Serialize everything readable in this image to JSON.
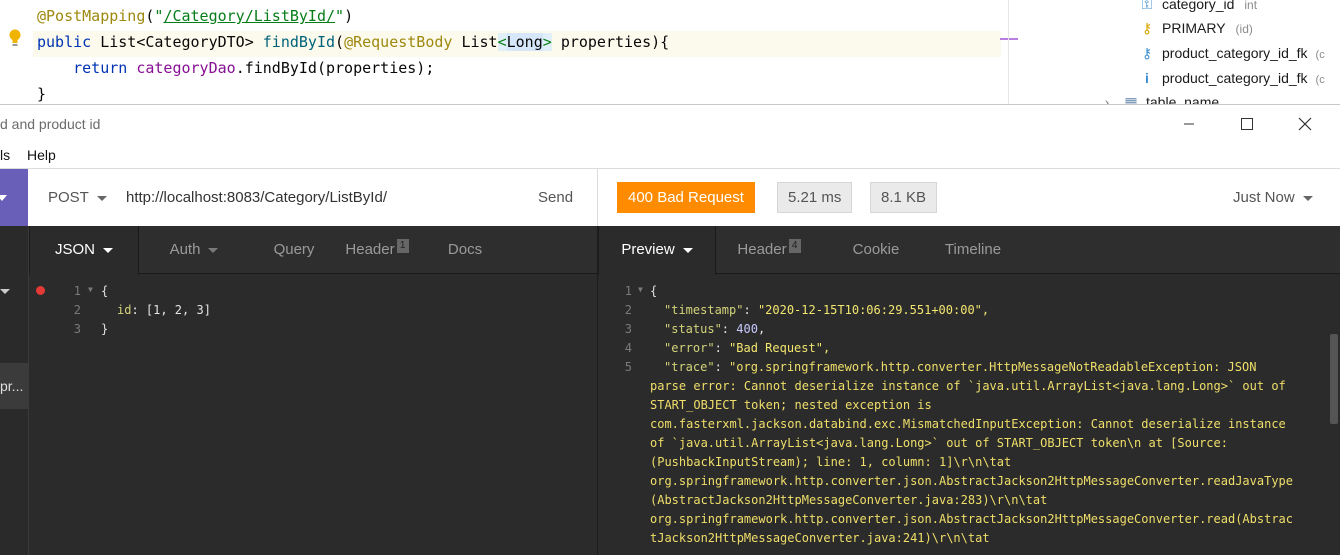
{
  "ide": {
    "lines": [
      {
        "annotation": "@PostMapping",
        "open": "(",
        "quote_open": "\"",
        "path": "/Category/ListById/",
        "quote_close": "\"",
        "close": ")"
      },
      {
        "kw": "public",
        "type": "List<CategoryDTO>",
        "method": "findById",
        "p_open": "(",
        "param_ann": "@RequestBody",
        "param_type_a": "List",
        "lt": "<",
        "param_generic": "Long",
        "gt": ">",
        "param_name": "properties",
        "end": "){"
      },
      {
        "kw": "return",
        "field": "categoryDao",
        "call": ".findById(properties);"
      },
      {
        "text": "}"
      }
    ],
    "db_tree": [
      {
        "icon": "key-column-icon",
        "label": "category_id",
        "meta": "int"
      },
      {
        "icon": "key-icon",
        "label": "PRIMARY",
        "meta": "(id)"
      },
      {
        "icon": "foreign-key-icon",
        "label": "product_category_id_fk",
        "meta": "(c"
      },
      {
        "icon": "index-icon",
        "label": "product_category_id_fk",
        "meta": "(c"
      },
      {
        "icon": "table-icon",
        "label": "table_name",
        "meta": ""
      }
    ]
  },
  "window": {
    "title": "d and product id",
    "menu": [
      "ls",
      "Help"
    ]
  },
  "request": {
    "method": "POST",
    "url": "http://localhost:8083/Category/ListById/",
    "send_label": "Send",
    "tabs": [
      {
        "label": "JSON"
      },
      {
        "label": "Auth"
      },
      {
        "label": "Query"
      },
      {
        "label": "Header",
        "badge": "1"
      },
      {
        "label": "Docs"
      }
    ],
    "body_lines": [
      {
        "num": "1",
        "text": "{"
      },
      {
        "num": "2",
        "key": "id",
        "value": "[1, 2, 3]"
      },
      {
        "num": "3",
        "text": "}"
      }
    ]
  },
  "sidebar": {
    "selected_label": "pr..."
  },
  "response": {
    "status": "400 Bad Request",
    "time": "5.21 ms",
    "size": "8.1 KB",
    "when": "Just Now",
    "status_color": "#ff8c00",
    "tabs": [
      {
        "label": "Preview"
      },
      {
        "label": "Header",
        "badge": "4"
      },
      {
        "label": "Cookie"
      },
      {
        "label": "Timeline"
      }
    ],
    "body": {
      "line1": {
        "num": "1",
        "text": "{"
      },
      "line2": {
        "num": "2",
        "key": "\"timestamp\"",
        "value": "\"2020-12-15T10:06:29.551+00:00\","
      },
      "line3": {
        "num": "3",
        "key": "\"status\"",
        "value": "400",
        "tail": ","
      },
      "line4": {
        "num": "4",
        "key": "\"error\"",
        "value": "\"Bad Request\","
      },
      "line5": {
        "num": "5",
        "key": "\"trace\"",
        "value": "\"org.springframework.http.converter.HttpMessageNotReadableException: JSON"
      },
      "wrap": [
        "parse error: Cannot deserialize instance of `java.util.ArrayList<java.lang.Long>` out of",
        "START_OBJECT token; nested exception is",
        "com.fasterxml.jackson.databind.exc.MismatchedInputException: Cannot deserialize instance",
        "of `java.util.ArrayList<java.lang.Long>` out of START_OBJECT token\\n at [Source:",
        "(PushbackInputStream); line: 1, column: 1]\\r\\n\\tat",
        "org.springframework.http.converter.json.AbstractJackson2HttpMessageConverter.readJavaType",
        "(AbstractJackson2HttpMessageConverter.java:283)\\r\\n\\tat",
        "org.springframework.http.converter.json.AbstractJackson2HttpMessageConverter.read(Abstrac",
        "tJackson2HttpMessageConverter.java:241)\\r\\n\\tat"
      ]
    }
  }
}
